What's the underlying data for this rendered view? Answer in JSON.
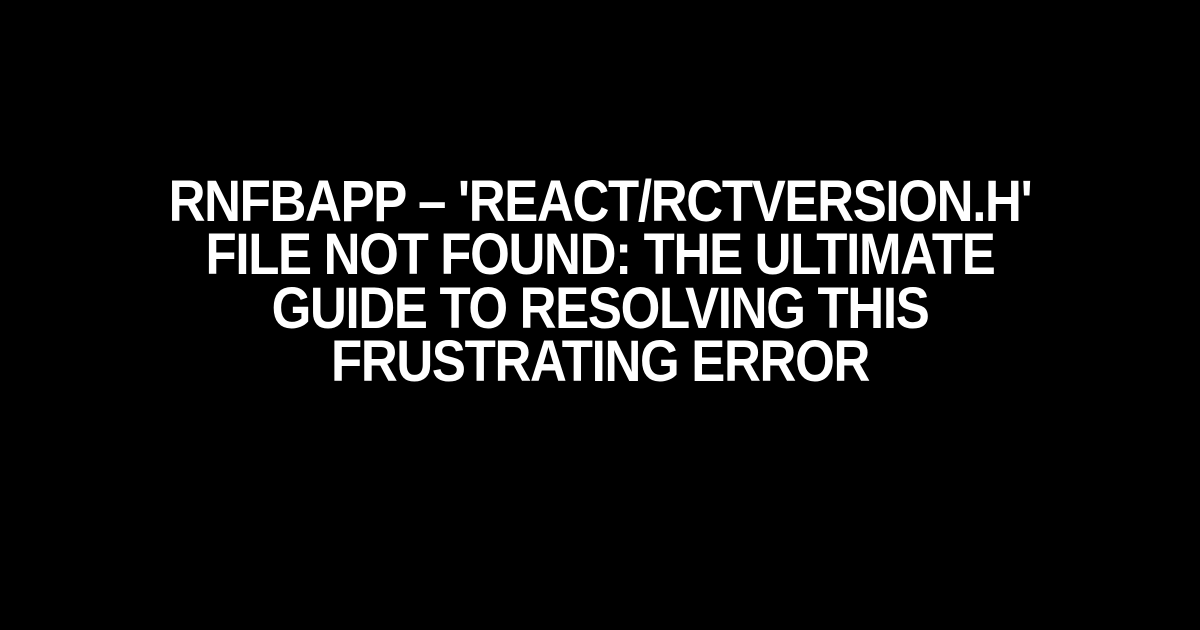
{
  "title": "RNFBAPP – 'REACT/RCTVERSION.H' FILE NOT FOUND: THE ULTIMATE GUIDE TO RESOLVING THIS FRUSTRATING ERROR"
}
